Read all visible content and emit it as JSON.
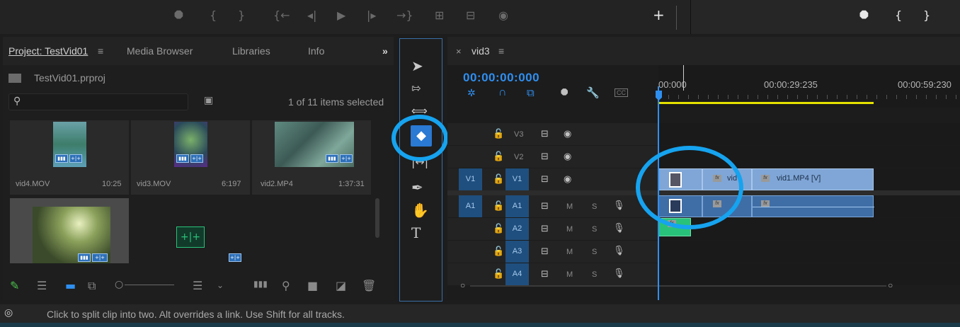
{
  "topbar": {
    "left_icons": [
      "marker-icon",
      "mark-in-icon",
      "mark-out-icon",
      "go-to-in-icon",
      "step-back-icon",
      "play-icon",
      "step-forward-icon",
      "go-to-out-icon",
      "insert-icon",
      "overwrite-icon",
      "export-frame-icon"
    ],
    "add_button": "+",
    "right_icons": [
      "marker-icon",
      "mark-in-icon",
      "mark-out-icon"
    ]
  },
  "project": {
    "tabs": [
      {
        "label": "Project: TestVid01",
        "menu": "≡"
      },
      {
        "label": "Media Browser"
      },
      {
        "label": "Libraries"
      },
      {
        "label": "Info"
      }
    ],
    "overflow": "»",
    "file": "TestVid01.prproj",
    "search": {
      "value": "",
      "placeholder": ""
    },
    "items_selected": "1 of 11 items selected",
    "items": [
      {
        "name": "vid4.MOV",
        "duration": "10:25"
      },
      {
        "name": "vid3.MOV",
        "duration": "6:197"
      },
      {
        "name": "vid2.MP4",
        "duration": "1:37:31"
      },
      {
        "name": "",
        "duration": ""
      },
      {
        "name": "",
        "duration": ""
      }
    ]
  },
  "tools": [
    "selection-tool",
    "track-select-tool",
    "ripple-edit-tool",
    "razor-tool",
    "slip-tool",
    "pen-tool",
    "hand-tool",
    "type-tool"
  ],
  "timeline": {
    "tab_label": "vid3",
    "close": "×",
    "menu": "≡",
    "timecode": "00:00:00:000",
    "ruler_labels": [
      "00:000",
      "00:00:29:235",
      "00:00:59:230"
    ],
    "cc": "CC",
    "video_tracks": [
      {
        "id": "V3",
        "source": ""
      },
      {
        "id": "V2",
        "source": ""
      },
      {
        "id": "V1",
        "source": "V1"
      }
    ],
    "audio_tracks": [
      {
        "id": "A1",
        "source": "A1",
        "m": "M",
        "s": "S"
      },
      {
        "id": "A2",
        "source": "",
        "m": "M",
        "s": "S"
      },
      {
        "id": "A3",
        "source": "",
        "m": "M",
        "s": "S"
      },
      {
        "id": "A4",
        "source": "",
        "m": "M",
        "s": "S"
      }
    ],
    "clips": {
      "v1_clip_a": "vid",
      "v1_clip_b": "vid1.MP4 [V]",
      "fx_label": "fx"
    }
  },
  "status": {
    "text": "Click to split clip into two. Alt overrides a link. Use Shift for all tracks."
  },
  "colors": {
    "accent": "#2f8ff0",
    "highlight_circle": "#16a3ef",
    "work_area": "#e5e200",
    "video_clip": "#7fa6d6",
    "audio_clip": "#3f6ea6",
    "audio_green": "#29c27a"
  }
}
